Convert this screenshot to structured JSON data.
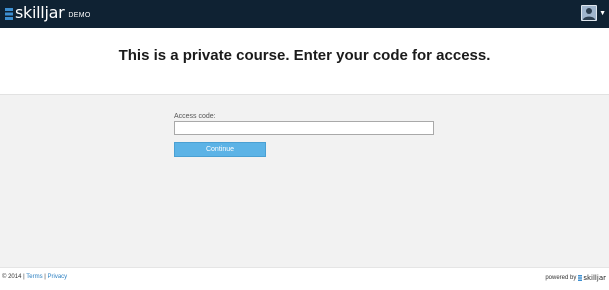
{
  "header": {
    "logo_text": "skilljar",
    "logo_badge": "DEMO",
    "user_menu_icon": "caret-down-icon"
  },
  "hero": {
    "title": "This is a private course. Enter your code for access."
  },
  "form": {
    "access_code_label": "Access code:",
    "access_code_value": "",
    "continue_label": "Continue"
  },
  "footer": {
    "copyright": "© 2014",
    "separator": "|",
    "terms_link": "Terms",
    "privacy_link": "Privacy",
    "powered_by": "powered by",
    "brand": "skilljar"
  },
  "colors": {
    "header_bg": "#0f2233",
    "button_bg": "#5cb3e6",
    "link": "#2a7fc1",
    "page_bg": "#f2f2f2"
  }
}
